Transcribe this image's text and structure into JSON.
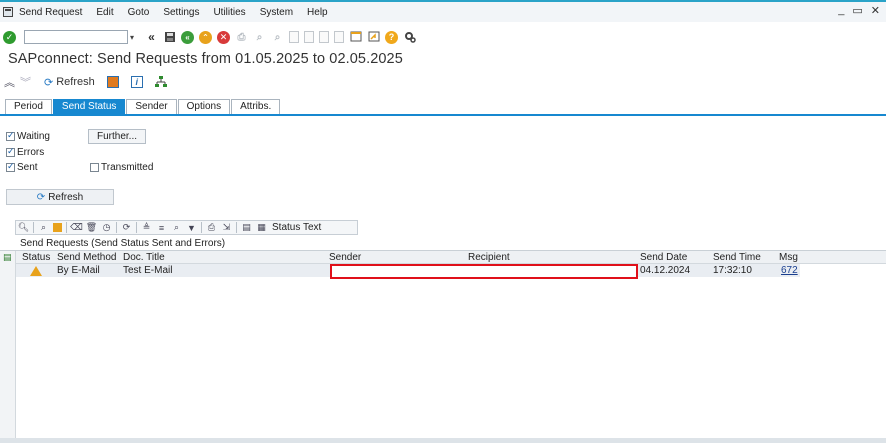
{
  "menubar": {
    "items": [
      "Send Request",
      "Edit",
      "Goto",
      "Settings",
      "Utilities",
      "System",
      "Help"
    ],
    "window_controls": [
      "_",
      "▭",
      "✕"
    ]
  },
  "toolbar": {
    "command_field_value": "",
    "icons": [
      "ok-icon",
      "back-icon",
      "save-icon",
      "green-back-icon",
      "exit-icon",
      "cancel-icon",
      "print-icon",
      "find-icon",
      "find-next-icon",
      "first-page-icon",
      "prev-page-icon",
      "next-page-icon",
      "last-page-icon",
      "new-session-icon",
      "shortcut-icon",
      "help-icon",
      "customize-icon"
    ]
  },
  "title": "SAPconnect: Send Requests from 01.05.2025 to 02.05.2025",
  "apptoolbar": {
    "refresh_label": "Refresh"
  },
  "tabs": [
    {
      "label": "Period",
      "active": false
    },
    {
      "label": "Send Status",
      "active": true
    },
    {
      "label": "Sender",
      "active": false
    },
    {
      "label": "Options",
      "active": false
    },
    {
      "label": "Attribs.",
      "active": false
    }
  ],
  "status_filter": {
    "waiting": {
      "label": "Waiting",
      "checked": true
    },
    "errors": {
      "label": "Errors",
      "checked": true
    },
    "sent": {
      "label": "Sent",
      "checked": true
    },
    "transmitted": {
      "label": "Transmitted",
      "checked": false
    },
    "further_label": "Further...",
    "refresh_label": "Refresh"
  },
  "alv": {
    "status_text_label": "Status Text",
    "grid_title": "Send Requests (Send Status Sent and Errors)",
    "columns": [
      "Status",
      "Send Method",
      "Doc. Title",
      "Sender",
      "Recipient",
      "Send Date",
      "Send Time",
      "Msg"
    ],
    "rows": [
      {
        "status_icon": "warning-icon",
        "send_method": "By E-Mail",
        "doc_title": "Test E-Mail",
        "sender": "",
        "recipient": "",
        "send_date": "04.12.2024",
        "send_time": "17:32:10",
        "msg": "672"
      }
    ]
  },
  "colors": {
    "accent": "#1788d0",
    "warning": "#e8a21c",
    "redaction_border": "#e0101a",
    "ok": "#2f9b2f"
  }
}
